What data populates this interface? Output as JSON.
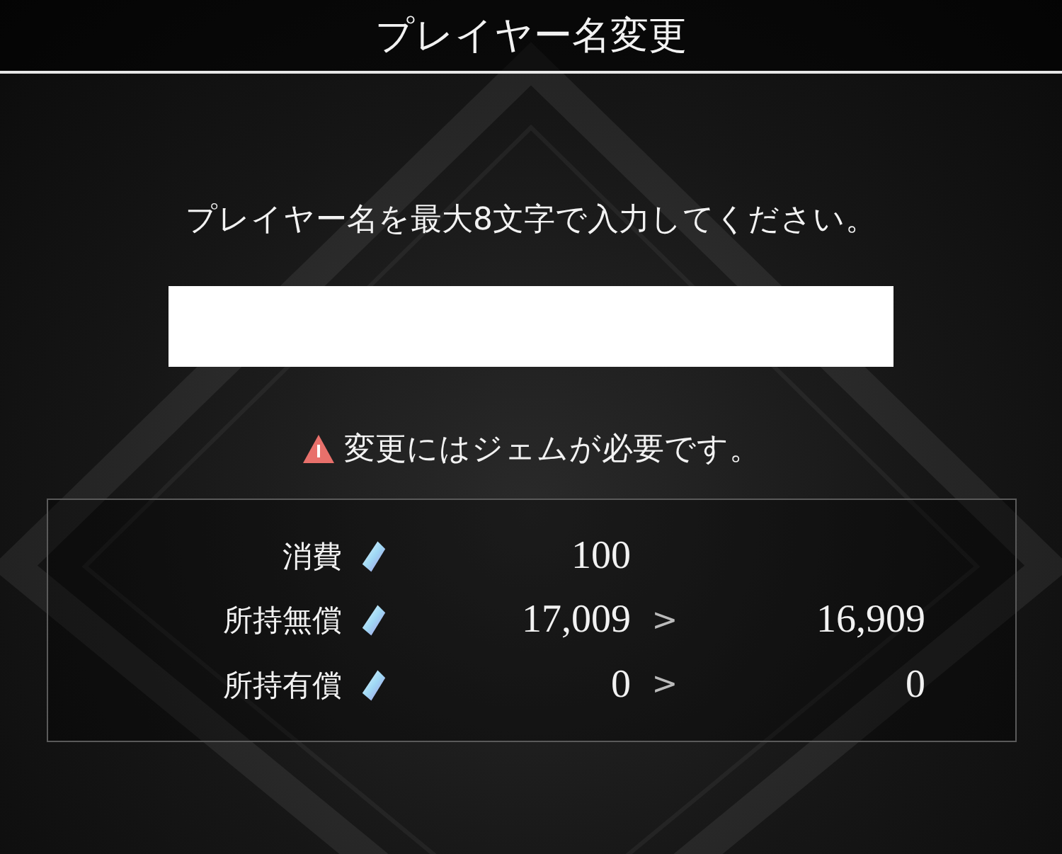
{
  "header": {
    "title": "プレイヤー名変更"
  },
  "prompt": "プレイヤー名を最大8文字で入力してください。",
  "warning": "変更にはジェムが必要です。",
  "gem_table": {
    "rows": [
      {
        "label": "消費",
        "value": "100"
      },
      {
        "label": "所持無償",
        "value": "17,009",
        "arrow": ">",
        "after": "16,909"
      },
      {
        "label": "所持有償",
        "value": "0",
        "arrow": ">",
        "after": "0"
      }
    ]
  }
}
